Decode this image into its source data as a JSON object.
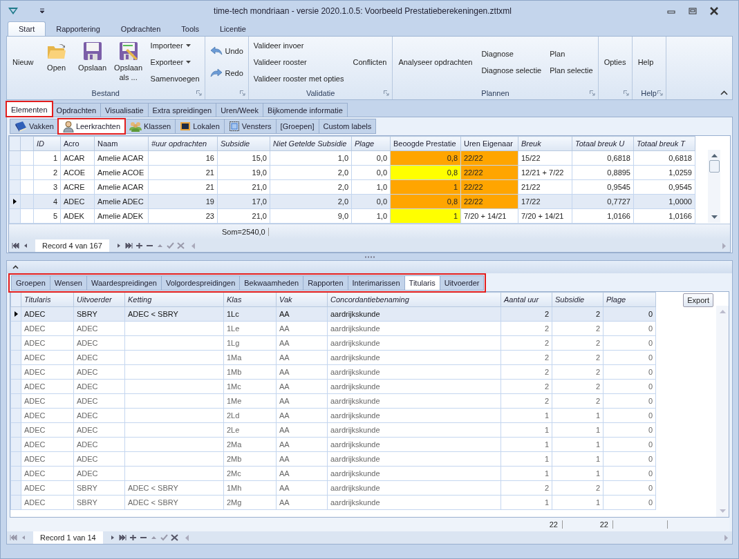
{
  "window": {
    "title": "time-tech mondriaan - versie 2020.1.0.5: Voorbeeld Prestatieberekeningen.zttxml"
  },
  "ribbon_tabs": [
    {
      "label": "Start",
      "selected": true
    },
    {
      "label": "Rapportering",
      "selected": false
    },
    {
      "label": "Opdrachten",
      "selected": false
    },
    {
      "label": "Tools",
      "selected": false
    },
    {
      "label": "Licentie",
      "selected": false
    }
  ],
  "ribbon_groups": [
    {
      "label": "Bestand",
      "columns": [
        [
          {
            "label": "Nieuw",
            "kind": "text"
          }
        ],
        [
          {
            "label": "Open",
            "kind": "open"
          }
        ],
        [
          {
            "label": "Opslaan",
            "kind": "save"
          }
        ],
        [
          {
            "label": "Opslaan als ...",
            "kind": "save-as"
          }
        ],
        [
          {
            "label": "Importeer",
            "kind": "menu"
          },
          {
            "label": "Exporteer",
            "kind": "menu"
          },
          {
            "label": "Samenvoegen",
            "kind": "small"
          }
        ]
      ]
    },
    {
      "columns": [
        [
          {
            "label": "Undo",
            "kind": "undo"
          },
          {
            "label": "Redo",
            "kind": "redo"
          }
        ]
      ]
    },
    {
      "label": "Validatie",
      "columns": [
        [
          {
            "label": "Valideer invoer",
            "kind": "small"
          },
          {
            "label": "Valideer rooster",
            "kind": "small"
          },
          {
            "label": "Valideer rooster met opties",
            "kind": "small"
          }
        ],
        [
          {
            "label": "Conflicten",
            "kind": "text"
          }
        ]
      ]
    },
    {
      "label": "Plannen",
      "columns": [
        [
          {
            "label": "Analyseer opdrachten",
            "kind": "text"
          }
        ],
        [
          {
            "label": "Diagnose",
            "kind": "small"
          },
          {
            "label": "Diagnose selectie",
            "kind": "small"
          }
        ],
        [
          {
            "label": "Plan",
            "kind": "small"
          },
          {
            "label": "Plan selectie",
            "kind": "small"
          }
        ]
      ]
    },
    {
      "columns": [
        [
          {
            "label": "Opties",
            "kind": "text"
          }
        ]
      ]
    },
    {
      "label": "Help",
      "columns": [
        [
          {
            "label": "Help",
            "kind": "text"
          }
        ]
      ]
    }
  ],
  "main_tabs": [
    {
      "label": "Elementen",
      "selected": true,
      "highlighted": true
    },
    {
      "label": "Opdrachten",
      "selected": false,
      "highlighted": false
    },
    {
      "label": "Visualisatie",
      "selected": false,
      "highlighted": false
    },
    {
      "label": "Extra spreidingen",
      "selected": false,
      "highlighted": false
    },
    {
      "label": "Uren/Week",
      "selected": false,
      "highlighted": false
    },
    {
      "label": "Bijkomende informatie",
      "selected": false,
      "highlighted": false
    }
  ],
  "element_tabs": [
    {
      "label": "Vakken",
      "kind": "book",
      "selected": false,
      "highlighted": false
    },
    {
      "label": "Leerkrachten",
      "kind": "person",
      "selected": true,
      "highlighted": true
    },
    {
      "label": "Klassen",
      "kind": "people",
      "selected": false,
      "highlighted": false
    },
    {
      "label": "Lokalen",
      "kind": "monitor",
      "selected": false,
      "highlighted": false
    },
    {
      "label": "Vensters",
      "kind": "frame",
      "selected": false,
      "highlighted": false
    },
    {
      "label": "[Groepen]",
      "kind": "text",
      "selected": false,
      "highlighted": false
    },
    {
      "label": "Custom labels",
      "kind": "text",
      "selected": false,
      "highlighted": false
    }
  ],
  "teacher_table": {
    "columns": [
      {
        "label": "ID",
        "italic": true
      },
      {
        "label": "Acro",
        "italic": false
      },
      {
        "label": "Naam",
        "italic": false
      },
      {
        "label": "#uur opdrachten",
        "italic": true
      },
      {
        "label": "Subsidie",
        "italic": true
      },
      {
        "label": "Niet Getelde Subsidie",
        "italic": true
      },
      {
        "label": "Plage",
        "italic": true
      },
      {
        "label": "Beoogde Prestatie",
        "italic": false
      },
      {
        "label": "Uren Eigenaar",
        "italic": false
      },
      {
        "label": "Breuk",
        "italic": true
      },
      {
        "label": "Totaal breuk U",
        "italic": true
      },
      {
        "label": "Totaal breuk T",
        "italic": true
      }
    ],
    "rows": [
      {
        "selected": false,
        "cells": [
          "1",
          "ACAR",
          "Amelie ACAR",
          "16",
          "15,0",
          "1,0",
          "0,0",
          {
            "text": "0,8",
            "color": "#ffa500"
          },
          {
            "text": "22/22",
            "color": "#ffa500"
          },
          "15/22",
          "0,6818",
          "0,6818"
        ]
      },
      {
        "selected": false,
        "cells": [
          "2",
          "ACOE",
          "Amelie ACOE",
          "21",
          "19,0",
          "2,0",
          "0,0",
          {
            "text": "0,8",
            "color": "#ffff00"
          },
          {
            "text": "22/22",
            "color": "#ffa500"
          },
          "12/21 + 7/22",
          "0,8895",
          "1,0259"
        ]
      },
      {
        "selected": false,
        "cells": [
          "3",
          "ACRE",
          "Amelie ACAR",
          "21",
          "21,0",
          "2,0",
          "1,0",
          {
            "text": "1",
            "color": "#ffa500"
          },
          {
            "text": "22/22",
            "color": "#ffa500"
          },
          "21/22",
          "0,9545",
          "0,9545"
        ]
      },
      {
        "selected": true,
        "cells": [
          "4",
          "ADEC",
          "Amelie ADEC",
          "19",
          "17,0",
          "2,0",
          "0,0",
          {
            "text": "0,8",
            "color": "#ffa500"
          },
          {
            "text": "22/22",
            "color": "#ffa500"
          },
          "17/22",
          "0,7727",
          "1,0000"
        ]
      },
      {
        "selected": false,
        "cells": [
          "5",
          "ADEK",
          "Amelie ADEK",
          "23",
          "21,0",
          "9,0",
          "1,0",
          {
            "text": "1",
            "color": "#ffff00"
          },
          {
            "text": "7/20 + 14/21"
          },
          "7/20 + 14/21",
          "1,0166",
          "1,0166"
        ]
      }
    ],
    "sum": "Som=2540,0",
    "record": "Record 4 van 167"
  },
  "detail_tabs": {
    "highlighted": true,
    "tabs": [
      {
        "label": "Groepen",
        "selected": false
      },
      {
        "label": "Wensen",
        "selected": false
      },
      {
        "label": "Waardespreidingen",
        "selected": false
      },
      {
        "label": "Volgordespreidingen",
        "selected": false
      },
      {
        "label": "Bekwaamheden",
        "selected": false
      },
      {
        "label": "Rapporten",
        "selected": false
      },
      {
        "label": "Interimarissen",
        "selected": false
      },
      {
        "label": "Titularis",
        "selected": true
      },
      {
        "label": "Uitvoerder",
        "selected": false
      }
    ]
  },
  "titularis_table": {
    "columns": [
      "Titularis",
      "Uitvoerder",
      "Ketting",
      "Klas",
      "Vak",
      "Concordantiebenaming",
      "Aantal uur",
      "Subsidie",
      "Plage"
    ],
    "rows": [
      {
        "selected": true,
        "cells": [
          "ADEC",
          "SBRY",
          "ADEC < SBRY",
          "1Lc",
          "AA",
          "aardrijkskunde",
          "2",
          "2",
          "0"
        ]
      },
      {
        "selected": false,
        "cells": [
          "ADEC",
          "ADEC",
          "",
          "1Le",
          "AA",
          "aardrijkskunde",
          "2",
          "2",
          "0"
        ]
      },
      {
        "selected": false,
        "cells": [
          "ADEC",
          "ADEC",
          "",
          "1Lg",
          "AA",
          "aardrijkskunde",
          "2",
          "2",
          "0"
        ]
      },
      {
        "selected": false,
        "cells": [
          "ADEC",
          "ADEC",
          "",
          "1Ma",
          "AA",
          "aardrijkskunde",
          "2",
          "2",
          "0"
        ]
      },
      {
        "selected": false,
        "cells": [
          "ADEC",
          "ADEC",
          "",
          "1Mb",
          "AA",
          "aardrijkskunde",
          "2",
          "2",
          "0"
        ]
      },
      {
        "selected": false,
        "cells": [
          "ADEC",
          "ADEC",
          "",
          "1Mc",
          "AA",
          "aardrijkskunde",
          "2",
          "2",
          "0"
        ]
      },
      {
        "selected": false,
        "cells": [
          "ADEC",
          "ADEC",
          "",
          "1Me",
          "AA",
          "aardrijkskunde",
          "2",
          "2",
          "0"
        ]
      },
      {
        "selected": false,
        "cells": [
          "ADEC",
          "ADEC",
          "",
          "2Ld",
          "AA",
          "aardrijkskunde",
          "1",
          "1",
          "0"
        ]
      },
      {
        "selected": false,
        "cells": [
          "ADEC",
          "ADEC",
          "",
          "2Le",
          "AA",
          "aardrijkskunde",
          "1",
          "1",
          "0"
        ]
      },
      {
        "selected": false,
        "cells": [
          "ADEC",
          "ADEC",
          "",
          "2Ma",
          "AA",
          "aardrijkskunde",
          "1",
          "1",
          "0"
        ]
      },
      {
        "selected": false,
        "cells": [
          "ADEC",
          "ADEC",
          "",
          "2Mb",
          "AA",
          "aardrijkskunde",
          "1",
          "1",
          "0"
        ]
      },
      {
        "selected": false,
        "cells": [
          "ADEC",
          "ADEC",
          "",
          "2Mc",
          "AA",
          "aardrijkskunde",
          "1",
          "1",
          "0"
        ]
      },
      {
        "selected": false,
        "cells": [
          "ADEC",
          "SBRY",
          "ADEC < SBRY",
          "1Mh",
          "AA",
          "aardrijkskunde",
          "2",
          "2",
          "0"
        ]
      },
      {
        "selected": false,
        "cells": [
          "ADEC",
          "SBRY",
          "ADEC < SBRY",
          "2Mg",
          "AA",
          "aardrijkskunde",
          "1",
          "1",
          "0"
        ]
      }
    ],
    "totals": [
      "22",
      "22"
    ],
    "export_button": "Export",
    "record": "Record 1 van 14"
  }
}
